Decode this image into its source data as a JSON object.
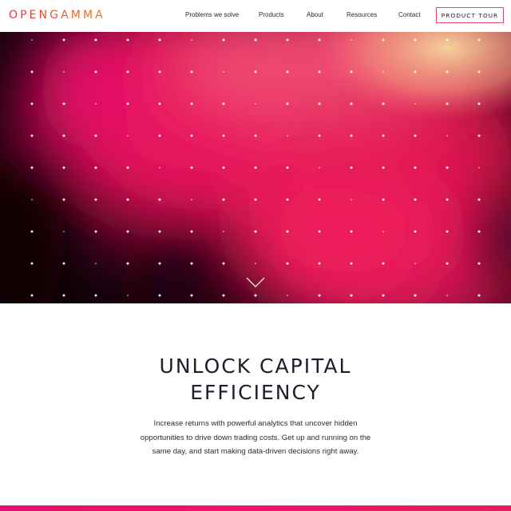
{
  "brand": {
    "logo_text": "OPENGAMMA",
    "accent_color": "#e8453a"
  },
  "nav": {
    "items": [
      {
        "label": "Problems we solve"
      },
      {
        "label": "Products"
      },
      {
        "label": "About"
      },
      {
        "label": "Resources"
      },
      {
        "label": "Contact"
      }
    ],
    "cta_label": "PRODUCT TOUR",
    "cta_border_color": "#e8456a"
  },
  "hero": {
    "background_colors": [
      "#0d0205",
      "#e0104f",
      "#f03f6a",
      "#f3b98a"
    ],
    "scroll_icon": "chevron-down-icon"
  },
  "content": {
    "headline_line1": "UNLOCK CAPITAL",
    "headline_line2": "EFFICIENCY",
    "body_line1": "Increase returns with powerful analytics that uncover hidden",
    "body_line2": "opportunities to drive down trading costs. Get up and running on the",
    "body_line3": "same day, and start making data-driven decisions right away."
  },
  "footer": {
    "bar_color": "#e8156a"
  }
}
